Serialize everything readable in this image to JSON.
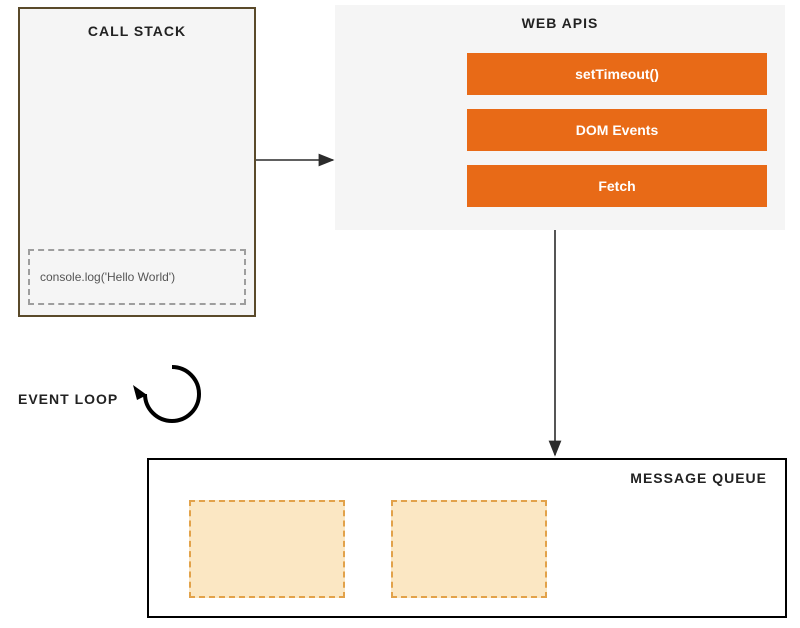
{
  "call_stack": {
    "title": "CALL STACK",
    "frame": "console.log('Hello World')"
  },
  "web_apis": {
    "title": "WEB APIS",
    "items": [
      "setTimeout()",
      "DOM Events",
      "Fetch"
    ]
  },
  "message_queue": {
    "title": "MESSAGE QUEUE"
  },
  "event_loop": {
    "label": "EVENT LOOP"
  },
  "colors": {
    "api_item_bg": "#e86a17",
    "queue_item_bg": "#fbe7c3",
    "queue_item_border": "#e2a24a",
    "panel_bg": "#f5f5f5"
  }
}
